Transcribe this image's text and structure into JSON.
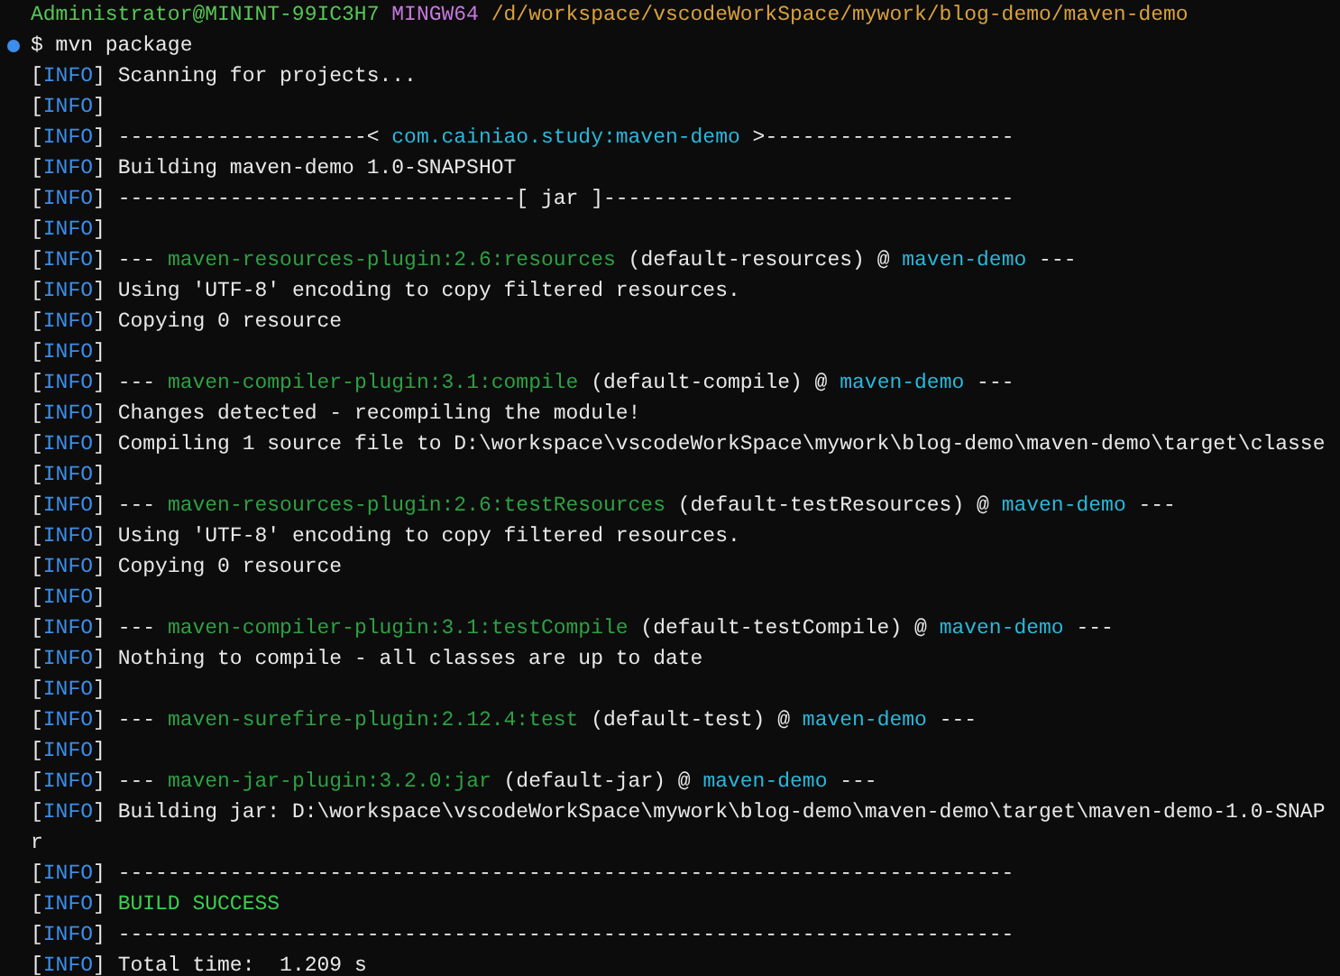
{
  "terminal": {
    "prompt": {
      "user": "Administrator@MININT-99IC3H7",
      "system": "MINGW64",
      "path": "/d/workspace/vscodeWorkSpace/mywork/blog-demo/maven-demo"
    },
    "command": {
      "symbol": "$",
      "text": "mvn package"
    },
    "lines": [
      {
        "tag": [
          "[",
          "INFO",
          "]"
        ],
        "segments": [
          {
            "kind": "text",
            "text": " Scanning for projects..."
          }
        ]
      },
      {
        "tag": [
          "[",
          "INFO",
          "]"
        ]
      },
      {
        "tag": [
          "[",
          "INFO",
          "]"
        ],
        "segments": [
          {
            "kind": "text",
            "text": " --------------------< "
          },
          {
            "kind": "artifact",
            "text": "com.cainiao.study:maven-demo"
          },
          {
            "kind": "text",
            "text": " >--------------------"
          }
        ]
      },
      {
        "tag": [
          "[",
          "INFO",
          "]"
        ],
        "segments": [
          {
            "kind": "text",
            "text": " Building maven-demo 1.0-SNAPSHOT"
          }
        ]
      },
      {
        "tag": [
          "[",
          "INFO",
          "]"
        ],
        "segments": [
          {
            "kind": "text",
            "text": " --------------------------------[ jar ]---------------------------------"
          }
        ]
      },
      {
        "tag": [
          "[",
          "INFO",
          "]"
        ]
      },
      {
        "tag": [
          "[",
          "INFO",
          "]"
        ],
        "segments": [
          {
            "kind": "text",
            "text": " --- "
          },
          {
            "kind": "plugin",
            "text": "maven-resources-plugin:2.6:resources"
          },
          {
            "kind": "text",
            "text": " (default-resources) @ "
          },
          {
            "kind": "artifact",
            "text": "maven-demo"
          },
          {
            "kind": "text",
            "text": " ---"
          }
        ]
      },
      {
        "tag": [
          "[",
          "INFO",
          "]"
        ],
        "segments": [
          {
            "kind": "text",
            "text": " Using 'UTF-8' encoding to copy filtered resources."
          }
        ]
      },
      {
        "tag": [
          "[",
          "INFO",
          "]"
        ],
        "segments": [
          {
            "kind": "text",
            "text": " Copying 0 resource"
          }
        ]
      },
      {
        "tag": [
          "[",
          "INFO",
          "]"
        ]
      },
      {
        "tag": [
          "[",
          "INFO",
          "]"
        ],
        "segments": [
          {
            "kind": "text",
            "text": " --- "
          },
          {
            "kind": "plugin",
            "text": "maven-compiler-plugin:3.1:compile"
          },
          {
            "kind": "text",
            "text": " (default-compile) @ "
          },
          {
            "kind": "artifact",
            "text": "maven-demo"
          },
          {
            "kind": "text",
            "text": " ---"
          }
        ]
      },
      {
        "tag": [
          "[",
          "INFO",
          "]"
        ],
        "segments": [
          {
            "kind": "text",
            "text": " Changes detected - recompiling the module!"
          }
        ]
      },
      {
        "tag": [
          "[",
          "INFO",
          "]"
        ],
        "segments": [
          {
            "kind": "text",
            "text": " Compiling 1 source file to D:\\workspace\\vscodeWorkSpace\\mywork\\blog-demo\\maven-demo\\target\\classe"
          }
        ]
      },
      {
        "tag": [
          "[",
          "INFO",
          "]"
        ]
      },
      {
        "tag": [
          "[",
          "INFO",
          "]"
        ],
        "segments": [
          {
            "kind": "text",
            "text": " --- "
          },
          {
            "kind": "plugin",
            "text": "maven-resources-plugin:2.6:testResources"
          },
          {
            "kind": "text",
            "text": " (default-testResources) @ "
          },
          {
            "kind": "artifact",
            "text": "maven-demo"
          },
          {
            "kind": "text",
            "text": " ---"
          }
        ]
      },
      {
        "tag": [
          "[",
          "INFO",
          "]"
        ],
        "segments": [
          {
            "kind": "text",
            "text": " Using 'UTF-8' encoding to copy filtered resources."
          }
        ]
      },
      {
        "tag": [
          "[",
          "INFO",
          "]"
        ],
        "segments": [
          {
            "kind": "text",
            "text": " Copying 0 resource"
          }
        ]
      },
      {
        "tag": [
          "[",
          "INFO",
          "]"
        ]
      },
      {
        "tag": [
          "[",
          "INFO",
          "]"
        ],
        "segments": [
          {
            "kind": "text",
            "text": " --- "
          },
          {
            "kind": "plugin",
            "text": "maven-compiler-plugin:3.1:testCompile"
          },
          {
            "kind": "text",
            "text": " (default-testCompile) @ "
          },
          {
            "kind": "artifact",
            "text": "maven-demo"
          },
          {
            "kind": "text",
            "text": " ---"
          }
        ]
      },
      {
        "tag": [
          "[",
          "INFO",
          "]"
        ],
        "segments": [
          {
            "kind": "text",
            "text": " Nothing to compile - all classes are up to date"
          }
        ]
      },
      {
        "tag": [
          "[",
          "INFO",
          "]"
        ]
      },
      {
        "tag": [
          "[",
          "INFO",
          "]"
        ],
        "segments": [
          {
            "kind": "text",
            "text": " --- "
          },
          {
            "kind": "plugin",
            "text": "maven-surefire-plugin:2.12.4:test"
          },
          {
            "kind": "text",
            "text": " (default-test) @ "
          },
          {
            "kind": "artifact",
            "text": "maven-demo"
          },
          {
            "kind": "text",
            "text": " ---"
          }
        ]
      },
      {
        "tag": [
          "[",
          "INFO",
          "]"
        ]
      },
      {
        "tag": [
          "[",
          "INFO",
          "]"
        ],
        "segments": [
          {
            "kind": "text",
            "text": " --- "
          },
          {
            "kind": "plugin",
            "text": "maven-jar-plugin:3.2.0:jar"
          },
          {
            "kind": "text",
            "text": " (default-jar) @ "
          },
          {
            "kind": "artifact",
            "text": "maven-demo"
          },
          {
            "kind": "text",
            "text": " ---"
          }
        ]
      },
      {
        "tag": [
          "[",
          "INFO",
          "]"
        ],
        "segments": [
          {
            "kind": "text",
            "text": " Building jar: D:\\workspace\\vscodeWorkSpace\\mywork\\blog-demo\\maven-demo\\target\\maven-demo-1.0-SNAP"
          }
        ]
      },
      {
        "segments": [
          {
            "kind": "text",
            "text": "r"
          }
        ]
      },
      {
        "tag": [
          "[",
          "INFO",
          "]"
        ],
        "segments": [
          {
            "kind": "text",
            "text": " ------------------------------------------------------------------------"
          }
        ]
      },
      {
        "tag": [
          "[",
          "INFO",
          "]"
        ],
        "segments": [
          {
            "kind": "success",
            "text": " BUILD SUCCESS"
          }
        ]
      },
      {
        "tag": [
          "[",
          "INFO",
          "]"
        ],
        "segments": [
          {
            "kind": "text",
            "text": " ------------------------------------------------------------------------"
          }
        ]
      },
      {
        "tag": [
          "[",
          "INFO",
          "]"
        ],
        "segments": [
          {
            "kind": "text",
            "text": " Total time:  1.209 s"
          }
        ]
      }
    ]
  }
}
